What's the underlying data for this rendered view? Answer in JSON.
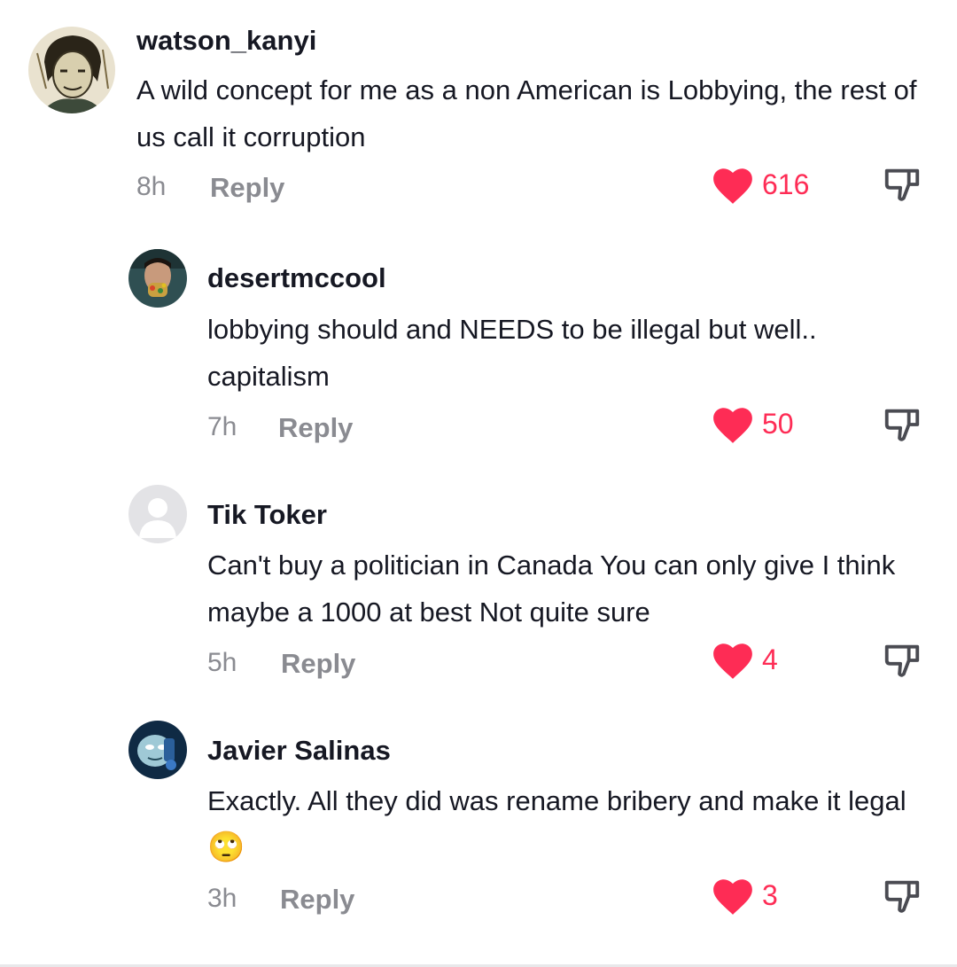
{
  "colors": {
    "like": "#fe2c55",
    "meta": "#8a8b91",
    "text": "#161823"
  },
  "comments": [
    {
      "username": "watson_kanyi",
      "text": "A wild concept for me as a non American is Lobbying, the rest of us call it corruption",
      "time": "8h",
      "reply_label": "Reply",
      "likes": "616",
      "avatar_icon": "profile-photo-icon"
    },
    {
      "username": "desertmccool",
      "text": "lobbying should and NEEDS to be illegal but well.. capitalism",
      "time": "7h",
      "reply_label": "Reply",
      "likes": "50",
      "avatar_icon": "profile-photo-icon"
    },
    {
      "username": "Tik Toker",
      "text": "Can't buy a politician in Canada You can only give I think maybe a 1000 at best Not quite sure",
      "time": "5h",
      "reply_label": "Reply",
      "likes": "4",
      "avatar_icon": "default-avatar-icon"
    },
    {
      "username": "Javier Salinas",
      "text": "Exactly. All they did was rename bribery and make it legal",
      "emoji": "🙄",
      "time": "3h",
      "reply_label": "Reply",
      "likes": "3",
      "avatar_icon": "profile-photo-icon"
    }
  ]
}
